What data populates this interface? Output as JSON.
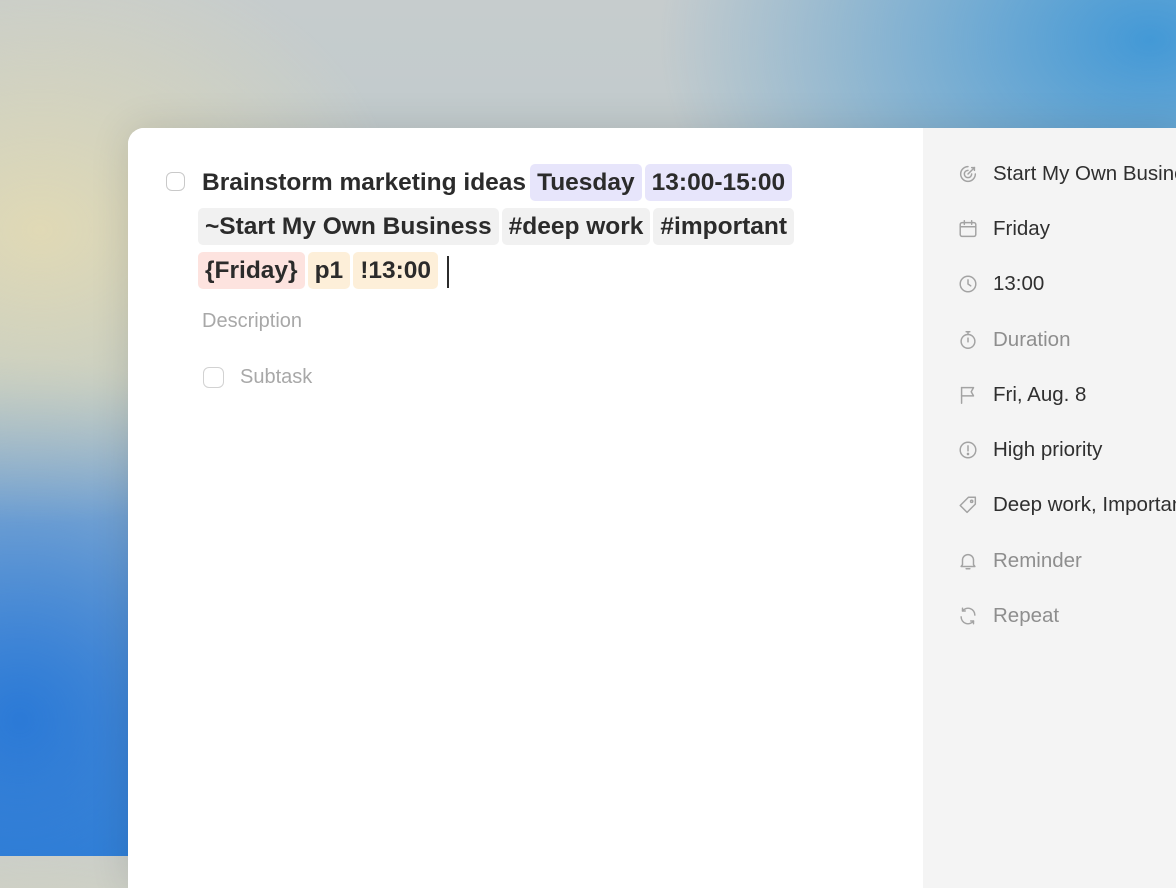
{
  "task": {
    "title_text": "Brainstorm marketing ideas",
    "tokens": {
      "date": "Tuesday",
      "time_range": "13:00-15:00",
      "project": "~Start My Own Business",
      "label_deep_work": "#deep work",
      "label_important": "#important",
      "deadline": "{Friday}",
      "priority": "p1",
      "reminder": "!13:00"
    },
    "description_placeholder": "Description",
    "subtask_placeholder": "Subtask"
  },
  "sidebar": {
    "project": "Start My Own Business",
    "date": "Friday",
    "time": "13:00",
    "duration": "Duration",
    "deadline": "Fri, Aug. 8",
    "priority": "High priority",
    "labels": "Deep work, Important",
    "reminder": "Reminder",
    "repeat": "Repeat"
  },
  "colors": {
    "token_purple": "#e7e5fb",
    "token_gray": "#f1f1f1",
    "token_red": "#fde3df",
    "token_orange": "#fdefd9"
  }
}
